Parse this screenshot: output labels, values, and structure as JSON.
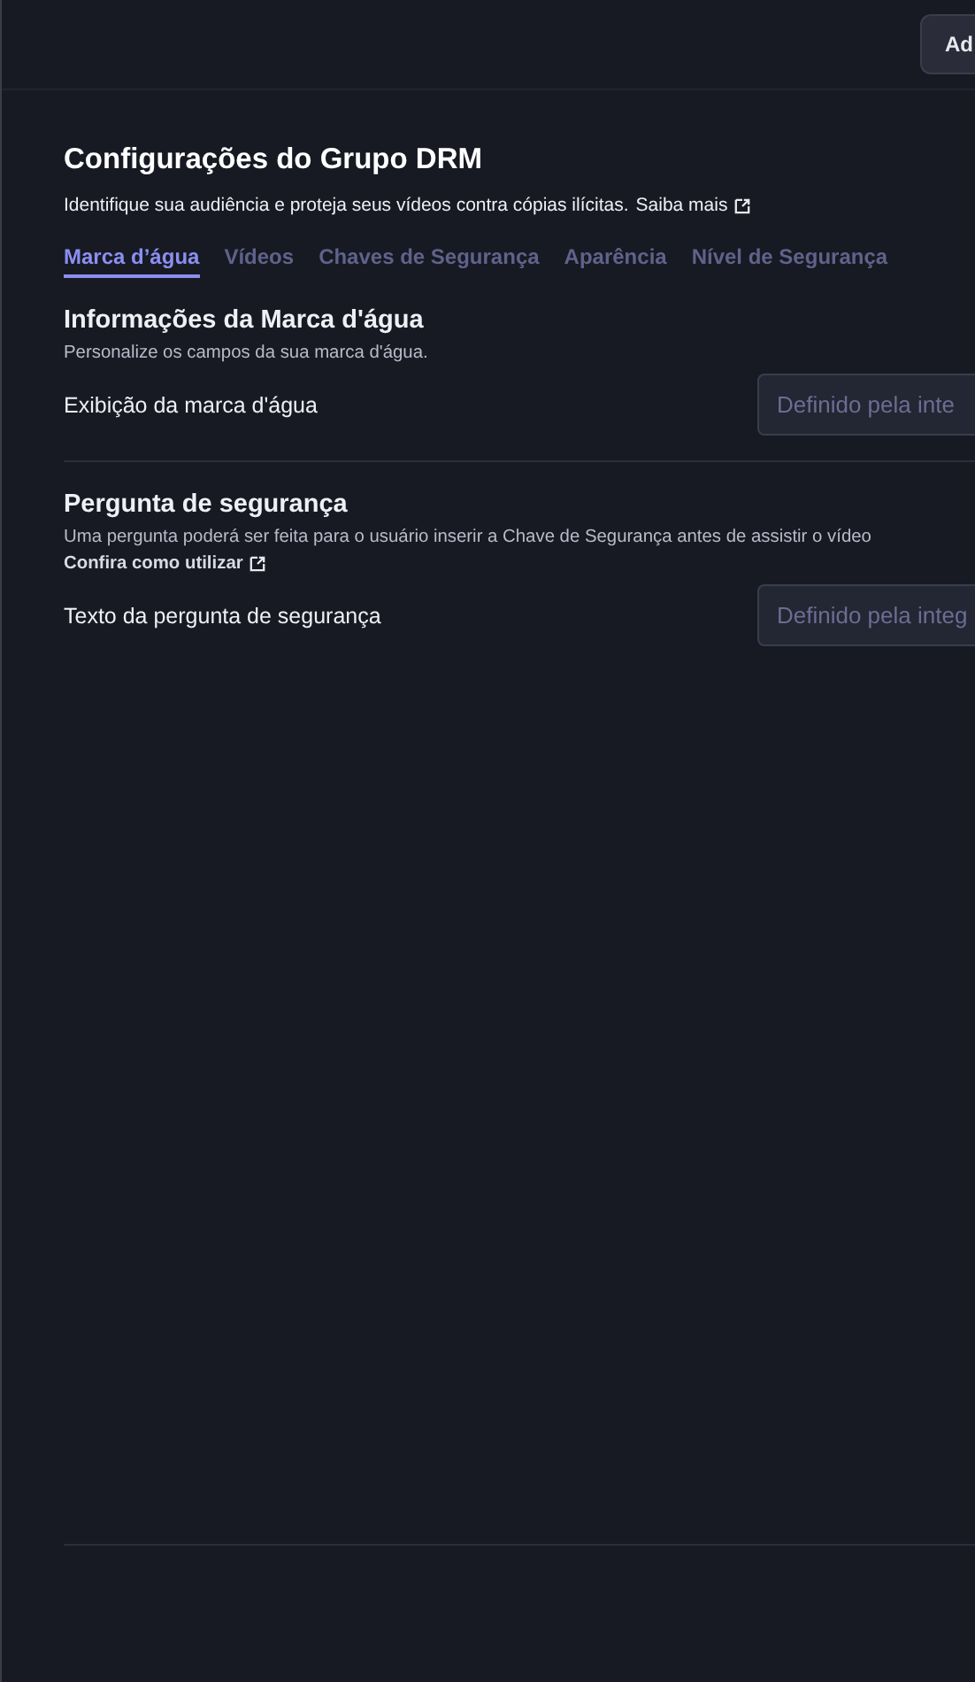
{
  "header": {
    "button": "Ad"
  },
  "title": "Configurações do Grupo DRM",
  "subtitle": "Identifique sua audiência e proteja seus vídeos contra cópias ilícitas.",
  "subtitle_link": "Saiba mais",
  "tabs": [
    {
      "label": "Marca d’água",
      "selected": true
    },
    {
      "label": "Vídeos",
      "selected": false
    },
    {
      "label": "Chaves de Segurança",
      "selected": false
    },
    {
      "label": "Aparência",
      "selected": false
    },
    {
      "label": "Nível de Segurança",
      "selected": false
    }
  ],
  "sections": [
    {
      "heading": "Informações da Marca d'água",
      "description": "Personalize os campos da sua marca d'água.",
      "fields": [
        {
          "label": "Exibição da marca d'água",
          "placeholder": "Definido pela inte"
        }
      ]
    },
    {
      "heading": "Pergunta de segurança",
      "description": "Uma pergunta poderá ser feita para o usuário inserir a Chave de Segurança antes de assistir o vídeo",
      "link": "Confira como utilizar",
      "fields": [
        {
          "label": "Texto da pergunta de segurança",
          "placeholder": "Definido pela integ"
        }
      ]
    }
  ]
}
